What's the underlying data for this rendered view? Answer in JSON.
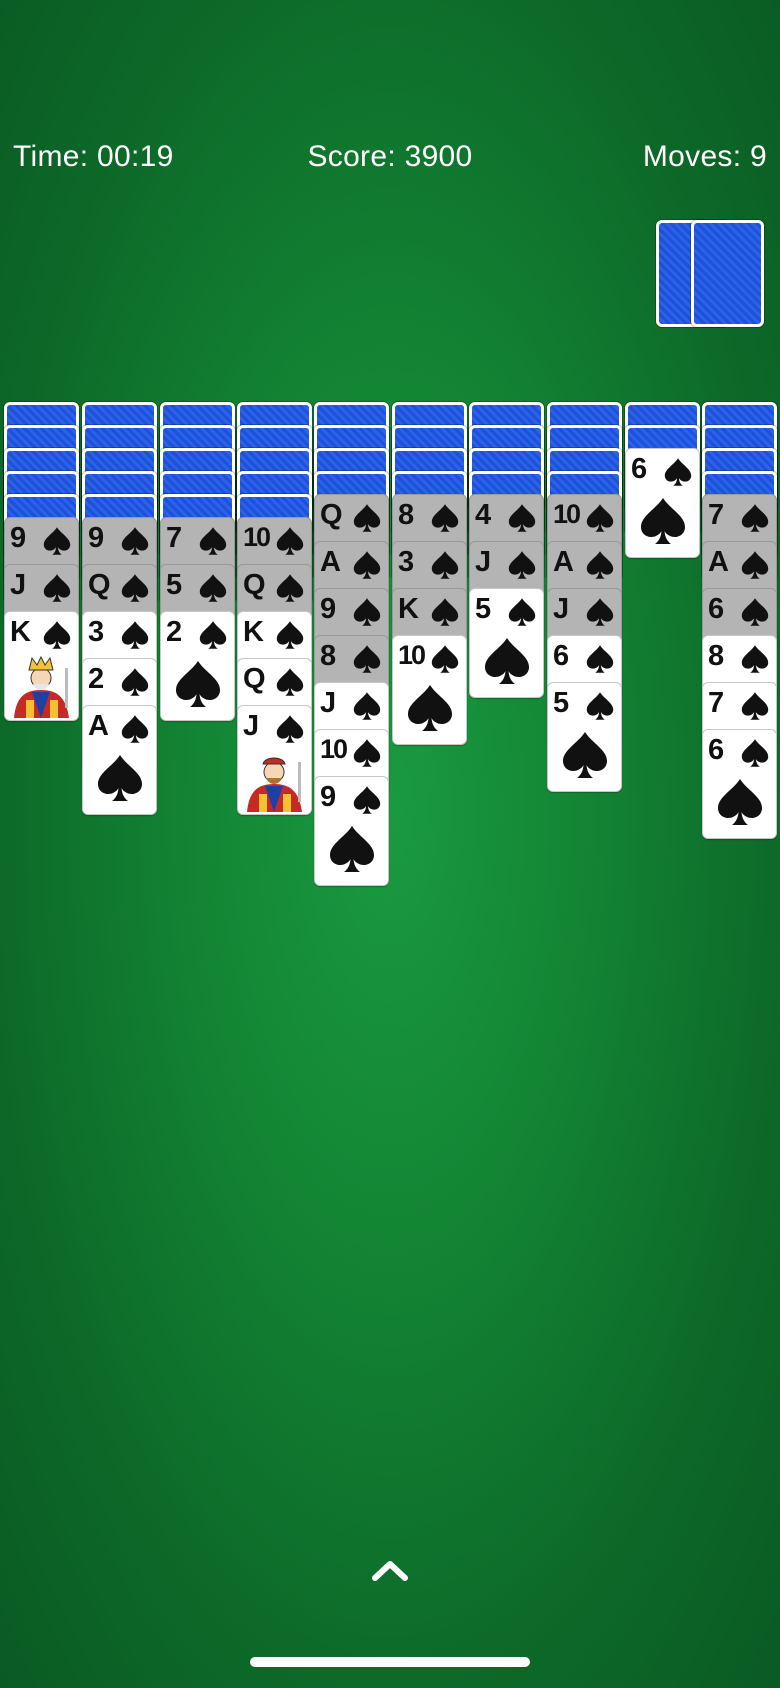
{
  "hud": {
    "time": "Time: 00:19",
    "score": "Score: 3900",
    "moves": "Moves: 9"
  },
  "stock": {
    "remaining_piles": 2
  },
  "suit": "spades",
  "tableau": [
    {
      "face_down": 5,
      "cards": [
        {
          "rank": "9",
          "dim": true
        },
        {
          "rank": "J",
          "dim": true
        },
        {
          "rank": "K",
          "dim": false
        }
      ]
    },
    {
      "face_down": 5,
      "cards": [
        {
          "rank": "9",
          "dim": true
        },
        {
          "rank": "Q",
          "dim": true
        },
        {
          "rank": "3",
          "dim": false
        },
        {
          "rank": "2",
          "dim": false
        },
        {
          "rank": "A",
          "dim": false
        }
      ]
    },
    {
      "face_down": 5,
      "cards": [
        {
          "rank": "7",
          "dim": true
        },
        {
          "rank": "5",
          "dim": true
        },
        {
          "rank": "2",
          "dim": false
        }
      ]
    },
    {
      "face_down": 5,
      "cards": [
        {
          "rank": "10",
          "dim": true
        },
        {
          "rank": "Q",
          "dim": true
        },
        {
          "rank": "K",
          "dim": false
        },
        {
          "rank": "Q",
          "dim": false
        },
        {
          "rank": "J",
          "dim": false
        }
      ]
    },
    {
      "face_down": 4,
      "cards": [
        {
          "rank": "Q",
          "dim": true
        },
        {
          "rank": "A",
          "dim": true
        },
        {
          "rank": "9",
          "dim": true
        },
        {
          "rank": "8",
          "dim": true
        },
        {
          "rank": "J",
          "dim": false
        },
        {
          "rank": "10",
          "dim": false
        },
        {
          "rank": "9",
          "dim": false
        }
      ]
    },
    {
      "face_down": 4,
      "cards": [
        {
          "rank": "8",
          "dim": true
        },
        {
          "rank": "3",
          "dim": true
        },
        {
          "rank": "K",
          "dim": true
        },
        {
          "rank": "10",
          "dim": false
        }
      ]
    },
    {
      "face_down": 4,
      "cards": [
        {
          "rank": "4",
          "dim": true
        },
        {
          "rank": "J",
          "dim": true
        },
        {
          "rank": "5",
          "dim": false
        }
      ]
    },
    {
      "face_down": 4,
      "cards": [
        {
          "rank": "10",
          "dim": true
        },
        {
          "rank": "A",
          "dim": true
        },
        {
          "rank": "J",
          "dim": true
        },
        {
          "rank": "6",
          "dim": false
        },
        {
          "rank": "5",
          "dim": false
        }
      ]
    },
    {
      "face_down": 2,
      "cards": [
        {
          "rank": "6",
          "dim": false
        }
      ]
    },
    {
      "face_down": 4,
      "cards": [
        {
          "rank": "7",
          "dim": true
        },
        {
          "rank": "A",
          "dim": true
        },
        {
          "rank": "6",
          "dim": true
        },
        {
          "rank": "8",
          "dim": false
        },
        {
          "rank": "7",
          "dim": false
        },
        {
          "rank": "6",
          "dim": false
        }
      ]
    }
  ],
  "colors": {
    "felt": "#138534",
    "card_back": "#2a62ea",
    "card_face": "#ffffff",
    "card_dimmed": "#b4b4b4"
  },
  "icons": {
    "deal_more": "chevron-up-icon",
    "suit": "spade-icon"
  }
}
